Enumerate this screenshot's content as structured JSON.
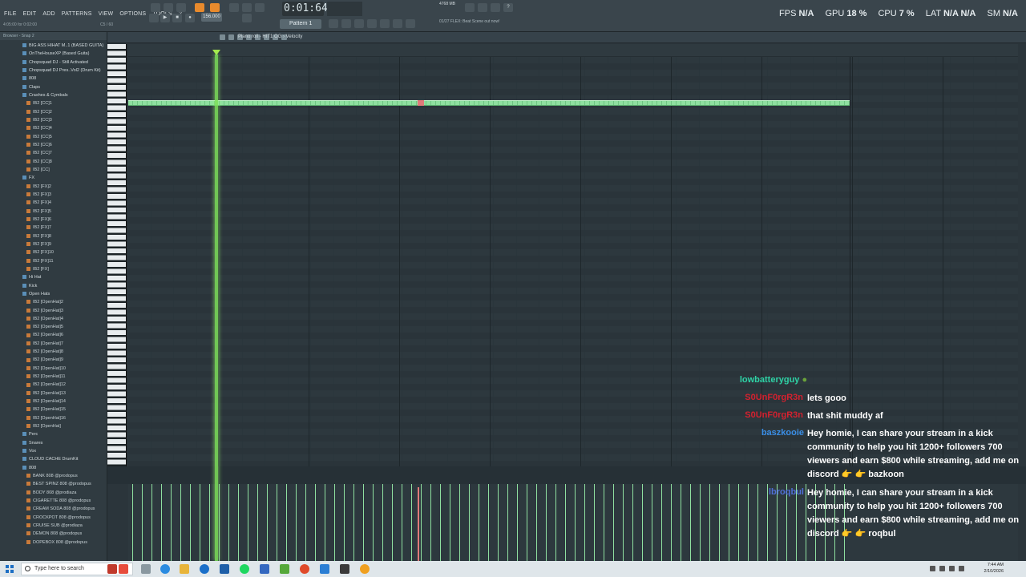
{
  "menu": [
    "FILE",
    "EDIT",
    "ADD",
    "PATTERNS",
    "VIEW",
    "OPTIONS",
    "TOOLS",
    "?"
  ],
  "hint_left": "4:05:00 for 0:02:00",
  "hint_right": "C5 / 60",
  "transport": {
    "time": "0:01:64",
    "tempo": "156.000",
    "pattern": "Pattern 1"
  },
  "memory": {
    "cpu_count": "2",
    "mb": "4768 MB",
    "voices": "4"
  },
  "news": "01/27 FLEX: Beat Scene out now!",
  "stats": [
    {
      "label": "FPS",
      "value": "N/A"
    },
    {
      "label": "GPU",
      "value": "18 %"
    },
    {
      "label": "CPU",
      "value": "7 %"
    },
    {
      "label": "LAT",
      "value": "N/A  N/A"
    },
    {
      "label": "SM",
      "value": "N/A"
    }
  ],
  "browser": {
    "header": "Browser - Snap 2",
    "items": [
      {
        "label": "BIG ASS HIHAT M..1 (BASED GUITA)",
        "type": "folder"
      },
      {
        "label": "OnTheHouseXP (Based Guita)",
        "type": "folder"
      },
      {
        "label": "Chopsquad DJ - Still Activated",
        "type": "folder"
      },
      {
        "label": "Chopsquad DJ Pres..Vol2 (Drum Kit)",
        "type": "folder"
      },
      {
        "label": "808",
        "type": "folder"
      },
      {
        "label": "Claps",
        "type": "folder"
      },
      {
        "label": "Crashes & Cymbals",
        "type": "folder"
      },
      {
        "label": "IB2 [CC]1",
        "type": "file"
      },
      {
        "label": "IB2 [CC]2",
        "type": "file"
      },
      {
        "label": "IB2 [CC]3",
        "type": "file"
      },
      {
        "label": "IB2 [CC]4",
        "type": "file"
      },
      {
        "label": "IB2 [CC]5",
        "type": "file"
      },
      {
        "label": "IB2 [CC]6",
        "type": "file"
      },
      {
        "label": "IB2 [CC]7",
        "type": "file"
      },
      {
        "label": "IB2 [CC]8",
        "type": "file"
      },
      {
        "label": "IB2 [CC]",
        "type": "file"
      },
      {
        "label": "FX",
        "type": "folder"
      },
      {
        "label": "IB2 [FX]2",
        "type": "file"
      },
      {
        "label": "IB2 [FX]3",
        "type": "file"
      },
      {
        "label": "IB2 [FX]4",
        "type": "file"
      },
      {
        "label": "IB2 [FX]5",
        "type": "file"
      },
      {
        "label": "IB2 [FX]6",
        "type": "file"
      },
      {
        "label": "IB2 [FX]7",
        "type": "file"
      },
      {
        "label": "IB2 [FX]8",
        "type": "file"
      },
      {
        "label": "IB2 [FX]9",
        "type": "file"
      },
      {
        "label": "IB2 [FX]10",
        "type": "file"
      },
      {
        "label": "IB2 [FX]11",
        "type": "file"
      },
      {
        "label": "IB2 [FX]",
        "type": "file"
      },
      {
        "label": "Hi Hat",
        "type": "folder"
      },
      {
        "label": "Kick",
        "type": "folder"
      },
      {
        "label": "Open Hats",
        "type": "folder"
      },
      {
        "label": "IB2 [OpenHat]2",
        "type": "file"
      },
      {
        "label": "IB2 [OpenHat]3",
        "type": "file"
      },
      {
        "label": "IB2 [OpenHat]4",
        "type": "file"
      },
      {
        "label": "IB2 [OpenHat]5",
        "type": "file"
      },
      {
        "label": "IB2 [OpenHat]6",
        "type": "file"
      },
      {
        "label": "IB2 [OpenHat]7",
        "type": "file"
      },
      {
        "label": "IB2 [OpenHat]8",
        "type": "file"
      },
      {
        "label": "IB2 [OpenHat]9",
        "type": "file"
      },
      {
        "label": "IB2 [OpenHat]10",
        "type": "file"
      },
      {
        "label": "IB2 [OpenHat]11",
        "type": "file"
      },
      {
        "label": "IB2 [OpenHat]12",
        "type": "file"
      },
      {
        "label": "IB2 [OpenHat]13",
        "type": "file"
      },
      {
        "label": "IB2 [OpenHat]14",
        "type": "file"
      },
      {
        "label": "IB2 [OpenHat]15",
        "type": "file"
      },
      {
        "label": "IB2 [OpenHat]16",
        "type": "file"
      },
      {
        "label": "IB2 [OpenHat]",
        "type": "file"
      },
      {
        "label": "Perc",
        "type": "folder"
      },
      {
        "label": "Snares",
        "type": "folder"
      },
      {
        "label": "Vox",
        "type": "folder"
      },
      {
        "label": "CLOUD CACHE DrumKit",
        "type": "folder"
      },
      {
        "label": "808",
        "type": "folder"
      },
      {
        "label": "BANK 808 @prodopus",
        "type": "file"
      },
      {
        "label": "BEST SPINZ 808 @prodopus",
        "type": "file"
      },
      {
        "label": "BODY 808 @prodiaza",
        "type": "file"
      },
      {
        "label": "CIGARETTE 808 @prodopus",
        "type": "file"
      },
      {
        "label": "CREAM SODA 808 @prodopus",
        "type": "file"
      },
      {
        "label": "CROCKPOT 808 @prodopus",
        "type": "file"
      },
      {
        "label": "CRUISE SUB @prodiaza",
        "type": "file"
      },
      {
        "label": "DEMON 808 @prodopus",
        "type": "file"
      },
      {
        "label": "DOPEBOX 808 @prodopus",
        "type": "file"
      }
    ]
  },
  "piano_roll": {
    "title": "Piano roll - HIT1 OG › Velocity"
  },
  "chat": [
    {
      "user": "lowbatteryguy",
      "user_color": "#2ed3a6",
      "message": ""
    },
    {
      "user": "S0UnF0rgR3n",
      "user_color": "#d4212f",
      "message": "lets gooo"
    },
    {
      "user": "S0UnF0rgR3n",
      "user_color": "#d4212f",
      "message": "that shit muddy af"
    },
    {
      "user": "baszkooie",
      "user_color": "#3a8ee6",
      "message_lines": [
        "Hey homie, I can share your stream in a kick",
        "community to help you hit 1200+ followers 700",
        "viewers and earn $800 while streaming, add me on",
        "discord 👉 👉  bazkoon"
      ]
    },
    {
      "user": "lbroqbul",
      "user_color": "#4f6fd8",
      "message_lines": [
        "Hey homie, I can share your stream in a kick",
        "community to help you hit 1200+ followers 700",
        "viewers and earn $800 while streaming, add me on",
        "discord 👉 👉  roqbul"
      ]
    }
  ],
  "taskbar": {
    "search_placeholder": "Type here to search",
    "time": "7:44 AM",
    "date": "2/10/2026"
  }
}
